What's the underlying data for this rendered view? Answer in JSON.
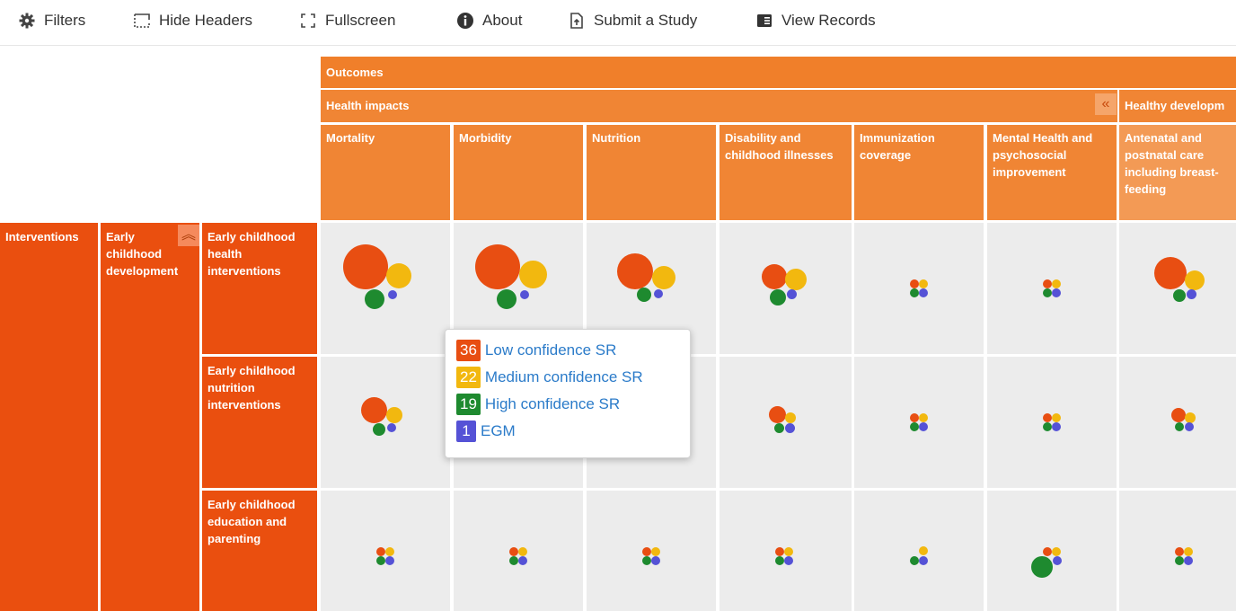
{
  "toolbar": {
    "items": [
      {
        "label": "Filters",
        "icon": "gear-icon"
      },
      {
        "label": "Hide Headers",
        "icon": "dashed-square-icon"
      },
      {
        "label": "Fullscreen",
        "icon": "expand-icon"
      },
      {
        "label": "About",
        "icon": "info-icon"
      },
      {
        "label": "Submit a Study",
        "icon": "file-upload-icon"
      },
      {
        "label": "View Records",
        "icon": "records-icon"
      }
    ]
  },
  "grid": {
    "outcomes_label": "Outcomes",
    "group_health_label": "Health impacts",
    "group_healthy_label": "Healthy developm",
    "columns": [
      "Mortality",
      "Morbidity",
      "Nutrition",
      "Disability and childhood illnesses",
      "Immunization coverage",
      "Mental Health and psychosocial improvement",
      "Antenatal and postnatal care including breast-feeding"
    ],
    "interventions_label": "Interventions",
    "ecd_label": "Early childhood development",
    "rows": [
      "Early childhood health interventions",
      "Early childhood nutrition interventions",
      "Early childhood education and parenting"
    ]
  },
  "colors": {
    "low": "#e84e12",
    "medium": "#f2b80f",
    "high": "#1e8a2f",
    "egm": "#5552d6"
  },
  "tooltip": {
    "items": [
      {
        "count": "36",
        "label": "Low confidence SR",
        "color": "#e84e12"
      },
      {
        "count": "22",
        "label": "Medium confidence SR",
        "color": "#f2b80f"
      },
      {
        "count": "19",
        "label": "High confidence SR",
        "color": "#1e8a2f"
      },
      {
        "count": "1",
        "label": "EGM",
        "color": "#5552d6"
      }
    ]
  }
}
